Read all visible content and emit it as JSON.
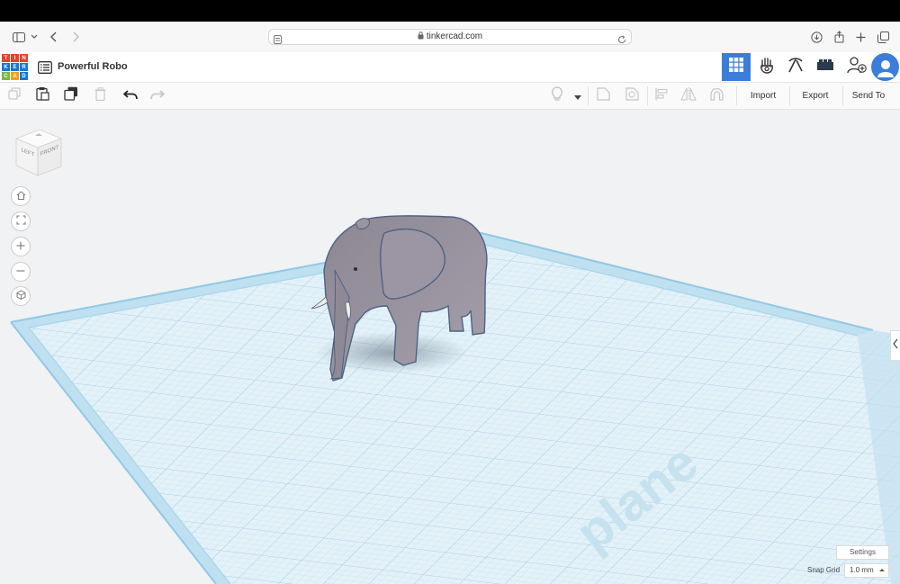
{
  "browser": {
    "url": "tinkercad.com",
    "icons": [
      "sidebar-icon",
      "chevron-down-icon",
      "back-icon",
      "forward-icon",
      "page-icon",
      "lock-icon",
      "reload-icon",
      "download-icon",
      "share-icon",
      "new-tab-icon",
      "tabs-icon"
    ]
  },
  "app": {
    "logo_letters": [
      "T",
      "I",
      "N",
      "K",
      "E",
      "R",
      "C",
      "A",
      "D"
    ],
    "logo_colors": [
      "#e8412c",
      "#e8412c",
      "#e8412c",
      "#1477d4",
      "#1477d4",
      "#1477d4",
      "#7ab648",
      "#f89d0e",
      "#1477d4"
    ],
    "doc_title": "Powerful Robo",
    "accent": "#3b7dd8"
  },
  "toolbar": {
    "import_label": "Import",
    "export_label": "Export",
    "sendto_label": "Send To"
  },
  "viewcube": {
    "left_label": "LEFT",
    "front_label": "FRONT"
  },
  "workplane": {
    "watermark": "plane"
  },
  "footer": {
    "settings_label": "Settings",
    "snap_grid_label": "Snap Grid",
    "snap_grid_value": "1.0 mm"
  }
}
